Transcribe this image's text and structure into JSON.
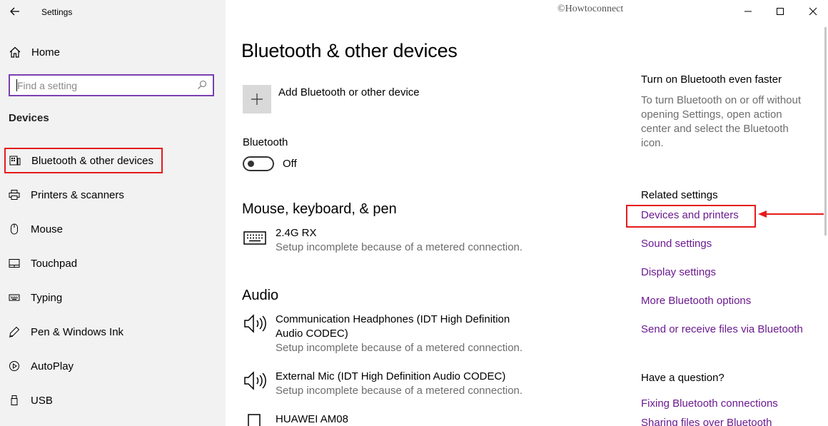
{
  "window": {
    "app_title": "Settings",
    "watermark": "©Howtoconnect"
  },
  "sidebar": {
    "home_label": "Home",
    "search_placeholder": "Find a setting",
    "section": "Devices",
    "items": [
      {
        "label": "Bluetooth & other devices",
        "icon": "bluetooth-devices-icon",
        "selected": true
      },
      {
        "label": "Printers & scanners",
        "icon": "printer-icon"
      },
      {
        "label": "Mouse",
        "icon": "mouse-icon"
      },
      {
        "label": "Touchpad",
        "icon": "touchpad-icon"
      },
      {
        "label": "Typing",
        "icon": "keyboard-icon"
      },
      {
        "label": "Pen & Windows Ink",
        "icon": "pen-icon"
      },
      {
        "label": "AutoPlay",
        "icon": "autoplay-icon"
      },
      {
        "label": "USB",
        "icon": "usb-icon"
      }
    ]
  },
  "main": {
    "title": "Bluetooth & other devices",
    "add_device_label": "Add Bluetooth or other device",
    "bluetooth_label": "Bluetooth",
    "bluetooth_state": "Off",
    "sections": {
      "mouse_keyboard_pen": "Mouse, keyboard, & pen",
      "audio": "Audio"
    },
    "input_devices": [
      {
        "name": "2.4G RX",
        "status": "Setup incomplete because of a metered connection."
      }
    ],
    "audio_devices": [
      {
        "name": "Communication Headphones (IDT High Definition Audio CODEC)",
        "status": "Setup incomplete because of a metered connection."
      },
      {
        "name": "External Mic (IDT High Definition Audio CODEC)",
        "status": "Setup incomplete because of a metered connection."
      },
      {
        "name": "HUAWEI AM08",
        "status": ""
      }
    ]
  },
  "right_pane": {
    "tip_title": "Turn on Bluetooth even faster",
    "tip_body": "To turn Bluetooth on or off without opening Settings, open action center and select the Bluetooth icon.",
    "related_heading": "Related settings",
    "related_links": [
      "Devices and printers",
      "Sound settings",
      "Display settings",
      "More Bluetooth options",
      "Send or receive files via Bluetooth"
    ],
    "question_heading": "Have a question?",
    "help_links": [
      "Fixing Bluetooth connections",
      "Sharing files over Bluetooth"
    ]
  },
  "colors": {
    "sidebar_bg": "#f2f2f2",
    "link": "#6b1a8f",
    "highlight": "#e51b1b",
    "search_border": "#7a3fb0"
  }
}
